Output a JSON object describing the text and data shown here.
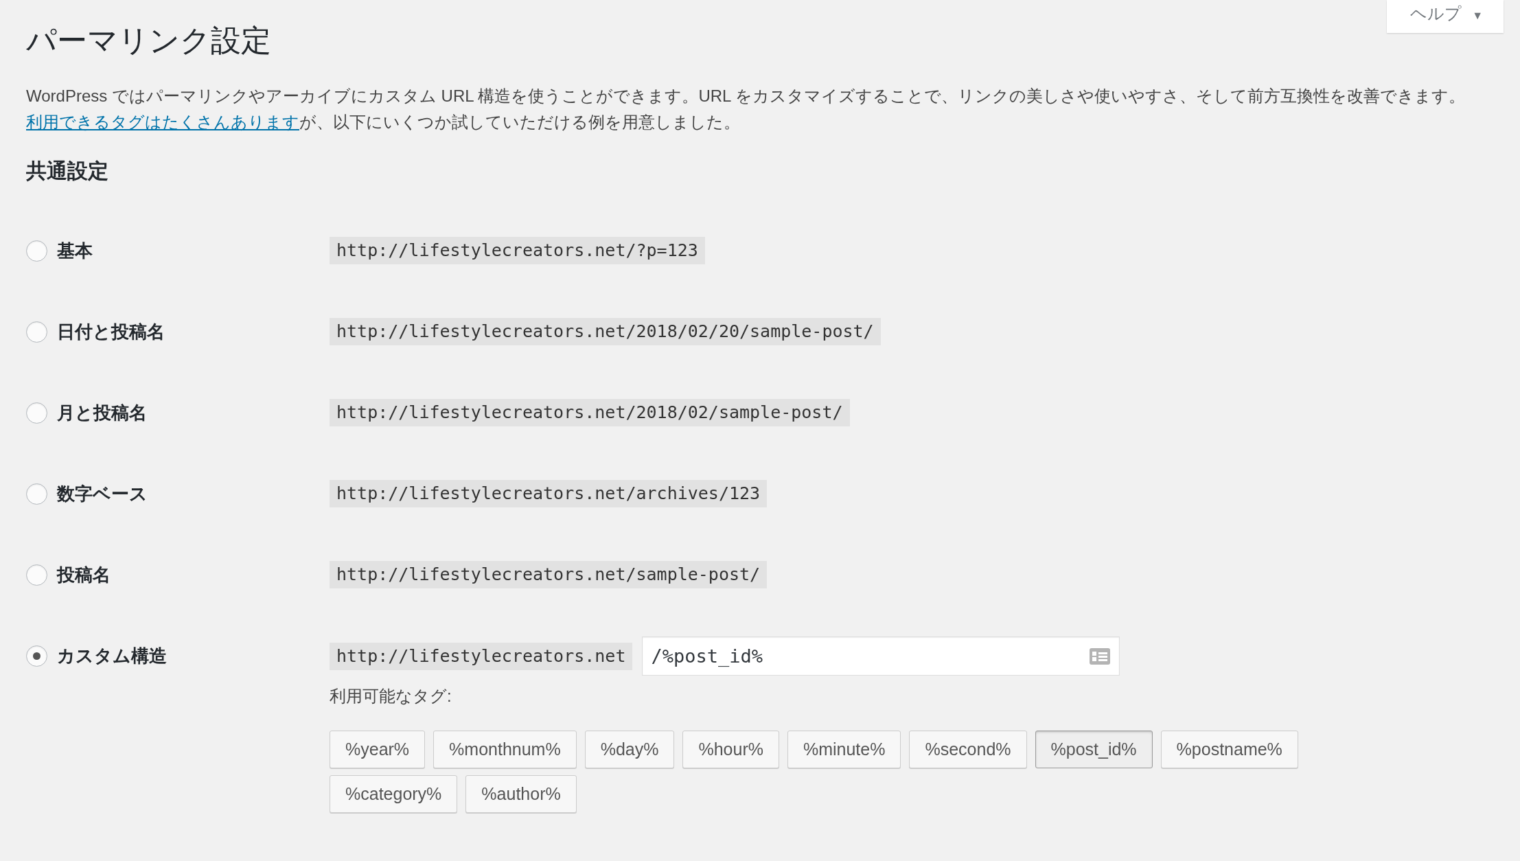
{
  "help_button": {
    "label": "ヘルプ",
    "caret": "▼"
  },
  "title": "パーマリンク設定",
  "description": {
    "before": "WordPress ではパーマリンクやアーカイブにカスタム URL 構造を使うことができます。URL をカスタマイズすることで、リンクの美しさや使いやすさ、そして前方互換性を改善できます。",
    "link": "利用できるタグはたくさんあります",
    "after": "が、以下にいくつか試していただける例を用意しました。"
  },
  "section_title": "共通設定",
  "options": [
    {
      "label": "基本",
      "example": "http://lifestylecreators.net/?p=123",
      "selected": false,
      "kind": "example"
    },
    {
      "label": "日付と投稿名",
      "example": "http://lifestylecreators.net/2018/02/20/sample-post/",
      "selected": false,
      "kind": "example"
    },
    {
      "label": "月と投稿名",
      "example": "http://lifestylecreators.net/2018/02/sample-post/",
      "selected": false,
      "kind": "example"
    },
    {
      "label": "数字ベース",
      "example": "http://lifestylecreators.net/archives/123",
      "selected": false,
      "kind": "example"
    },
    {
      "label": "投稿名",
      "example": "http://lifestylecreators.net/sample-post/",
      "selected": false,
      "kind": "example"
    },
    {
      "label": "カスタム構造",
      "example": "http://lifestylecreators.net",
      "value": "/%post_id%",
      "selected": true,
      "kind": "custom"
    }
  ],
  "available_tags_label": "利用可能なタグ:",
  "tags": [
    {
      "label": "%year%",
      "selected": false
    },
    {
      "label": "%monthnum%",
      "selected": false
    },
    {
      "label": "%day%",
      "selected": false
    },
    {
      "label": "%hour%",
      "selected": false
    },
    {
      "label": "%minute%",
      "selected": false
    },
    {
      "label": "%second%",
      "selected": false
    },
    {
      "label": "%post_id%",
      "selected": true
    },
    {
      "label": "%postname%",
      "selected": false
    },
    {
      "label": "%category%",
      "selected": false
    },
    {
      "label": "%author%",
      "selected": false
    }
  ]
}
